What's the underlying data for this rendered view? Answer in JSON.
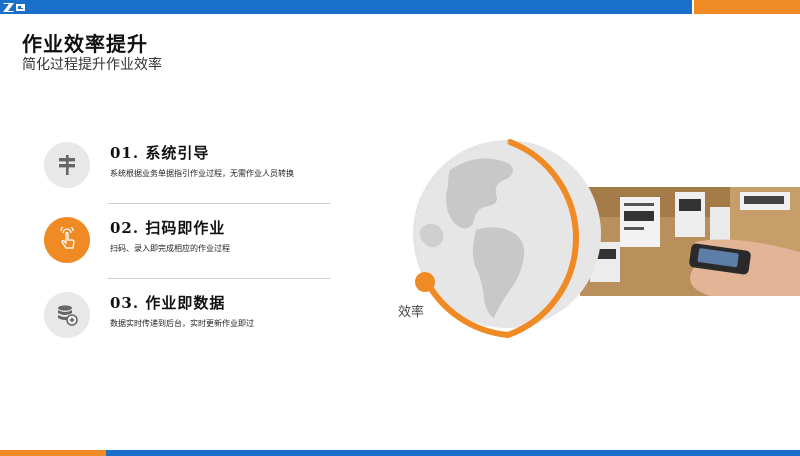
{
  "header": {
    "title": "作业效率提升",
    "subtitle": "简化过程提升作业效率"
  },
  "items": [
    {
      "heading": "01. 系统引导",
      "desc": "系统根据业务单据指引作业过程，无需作业人员转换",
      "icon": "signpost-icon"
    },
    {
      "heading": "02. 扫码即作业",
      "desc": "扫码、录入即完成相应的作业过程",
      "icon": "tap-hand-icon"
    },
    {
      "heading": "03. 作业即数据",
      "desc": "数据实时传递到后台，实时更新作业即过",
      "icon": "database-icon"
    }
  ],
  "visual": {
    "label": "效率"
  },
  "colors": {
    "blue": "#1a6fcb",
    "orange": "#f08a24",
    "gray": "#e8e8e8"
  }
}
